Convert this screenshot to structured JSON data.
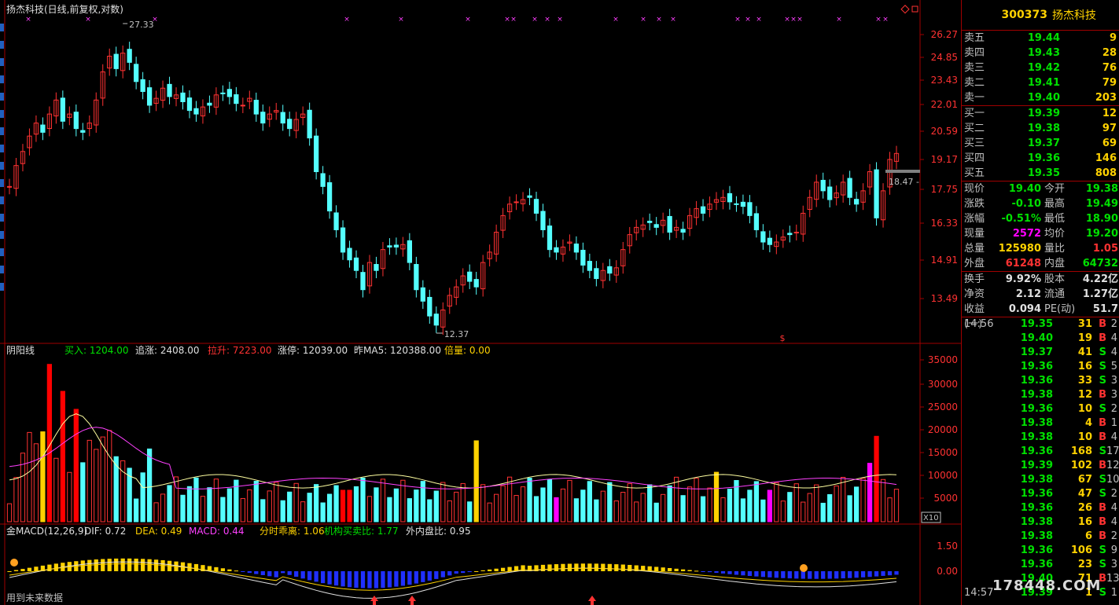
{
  "main_panel": {
    "title": "扬杰科技(日线,前复权,对数)",
    "y_ticks": [
      "26.27",
      "24.85",
      "23.43",
      "22.01",
      "20.59",
      "19.17",
      "17.75",
      "16.33",
      "14.91",
      "13.49"
    ],
    "high_label": "27.33",
    "low_label": "12.37",
    "current_tag": "18.47",
    "dollar_marker": "$"
  },
  "volume_panel": {
    "title": "阴阳线",
    "buy": "买入: 1204.00",
    "chase": "追涨: 2408.00",
    "pull": "拉升: 7223.00",
    "limit": "涨停: 12039.00",
    "prev_ma5": "昨MA5: 120388.00",
    "multiple": "倍量: 0.00",
    "y_ticks": [
      "35000",
      "30000",
      "25000",
      "20000",
      "15000",
      "10000",
      "5000"
    ],
    "scale_tag": "X10"
  },
  "macd_panel": {
    "title": "金MACD(12,26,9)",
    "dif": "DIF: 0.72",
    "dea": "DEA: 0.49",
    "macd": "MACD: 0.44",
    "divergence": "分时乖离: 1.06",
    "inst_ratio": "机构买卖比: 1.77",
    "inout_ratio": "外内盘比: 0.95",
    "y_ticks": [
      "1.50",
      "0.00"
    ],
    "footer": "用到未来数据"
  },
  "side_panel": {
    "code": "300373",
    "name": "扬杰科技",
    "asks": [
      {
        "label": "卖五",
        "price": "19.44",
        "vol": "9"
      },
      {
        "label": "卖四",
        "price": "19.43",
        "vol": "28"
      },
      {
        "label": "卖三",
        "price": "19.42",
        "vol": "76"
      },
      {
        "label": "卖二",
        "price": "19.41",
        "vol": "79"
      },
      {
        "label": "卖一",
        "price": "19.40",
        "vol": "203"
      }
    ],
    "bids": [
      {
        "label": "买一",
        "price": "19.39",
        "vol": "12"
      },
      {
        "label": "买二",
        "price": "19.38",
        "vol": "97"
      },
      {
        "label": "买三",
        "price": "19.37",
        "vol": "69"
      },
      {
        "label": "买四",
        "price": "19.36",
        "vol": "146"
      },
      {
        "label": "买五",
        "price": "19.35",
        "vol": "808"
      }
    ],
    "quote": [
      {
        "l1": "现价",
        "v1": "19.40",
        "c1": "grn",
        "l2": "今开",
        "v2": "19.38",
        "c2": "grn"
      },
      {
        "l1": "涨跌",
        "v1": "-0.10",
        "c1": "grn",
        "l2": "最高",
        "v2": "19.49",
        "c2": "grn"
      },
      {
        "l1": "涨幅",
        "v1": "-0.51%",
        "c1": "grn",
        "l2": "最低",
        "v2": "18.90",
        "c2": "grn"
      },
      {
        "l1": "现量",
        "v1": "2572",
        "c1": "mag",
        "l2": "均价",
        "v2": "19.20",
        "c2": "grn"
      },
      {
        "l1": "总量",
        "v1": "125980",
        "c1": "yel",
        "l2": "量比",
        "v2": "1.05",
        "c2": "red"
      },
      {
        "l1": "外盘",
        "v1": "61248",
        "c1": "red",
        "l2": "内盘",
        "v2": "64732",
        "c2": "grn"
      }
    ],
    "fundamentals": [
      {
        "l1": "换手",
        "v1": "9.92%",
        "l2": "股本",
        "v2": "4.22亿"
      },
      {
        "l1": "净资",
        "v1": "2.12",
        "l2": "流通",
        "v2": "1.27亿"
      },
      {
        "l1": "收益(一)",
        "v1": "0.094",
        "l2": "PE(动)",
        "v2": "51.7"
      }
    ],
    "ticks": [
      {
        "time": "14:56",
        "price": "19.35",
        "vol": "31",
        "bs": "B",
        "cnt": "2"
      },
      {
        "time": "",
        "price": "19.40",
        "vol": "19",
        "bs": "B",
        "cnt": "4"
      },
      {
        "time": "",
        "price": "19.37",
        "vol": "41",
        "bs": "S",
        "cnt": "4"
      },
      {
        "time": "",
        "price": "19.36",
        "vol": "16",
        "bs": "S",
        "cnt": "5"
      },
      {
        "time": "",
        "price": "19.36",
        "vol": "33",
        "bs": "S",
        "cnt": "3"
      },
      {
        "time": "",
        "price": "19.38",
        "vol": "12",
        "bs": "B",
        "cnt": "3"
      },
      {
        "time": "",
        "price": "19.36",
        "vol": "10",
        "bs": "S",
        "cnt": "2"
      },
      {
        "time": "",
        "price": "19.38",
        "vol": "4",
        "bs": "B",
        "cnt": "1"
      },
      {
        "time": "",
        "price": "19.38",
        "vol": "10",
        "bs": "B",
        "cnt": "4"
      },
      {
        "time": "",
        "price": "19.36",
        "vol": "168",
        "bs": "S",
        "cnt": "17"
      },
      {
        "time": "",
        "price": "19.39",
        "vol": "102",
        "bs": "B",
        "cnt": "12"
      },
      {
        "time": "",
        "price": "19.38",
        "vol": "67",
        "bs": "S",
        "cnt": "10"
      },
      {
        "time": "",
        "price": "19.36",
        "vol": "47",
        "bs": "S",
        "cnt": "2"
      },
      {
        "time": "",
        "price": "19.36",
        "vol": "26",
        "bs": "B",
        "cnt": "4"
      },
      {
        "time": "",
        "price": "19.38",
        "vol": "16",
        "bs": "B",
        "cnt": "4"
      },
      {
        "time": "",
        "price": "19.38",
        "vol": "6",
        "bs": "B",
        "cnt": "2"
      },
      {
        "time": "",
        "price": "19.36",
        "vol": "106",
        "bs": "S",
        "cnt": "9"
      },
      {
        "time": "",
        "price": "19.36",
        "vol": "23",
        "bs": "S",
        "cnt": "3"
      },
      {
        "time": "",
        "price": "19.40",
        "vol": "71",
        "bs": "B",
        "cnt": "13"
      },
      {
        "time": "14:57",
        "price": "19.39",
        "vol": "1",
        "bs": "S",
        "cnt": "1"
      }
    ]
  },
  "watermark": "178448.COM",
  "colors": {
    "up": "#ff3232",
    "down": "#54ffff",
    "grid": "#a00000",
    "yellow": "#ffd200",
    "magenta": "#ff00ff",
    "blue": "#2030ff"
  }
}
